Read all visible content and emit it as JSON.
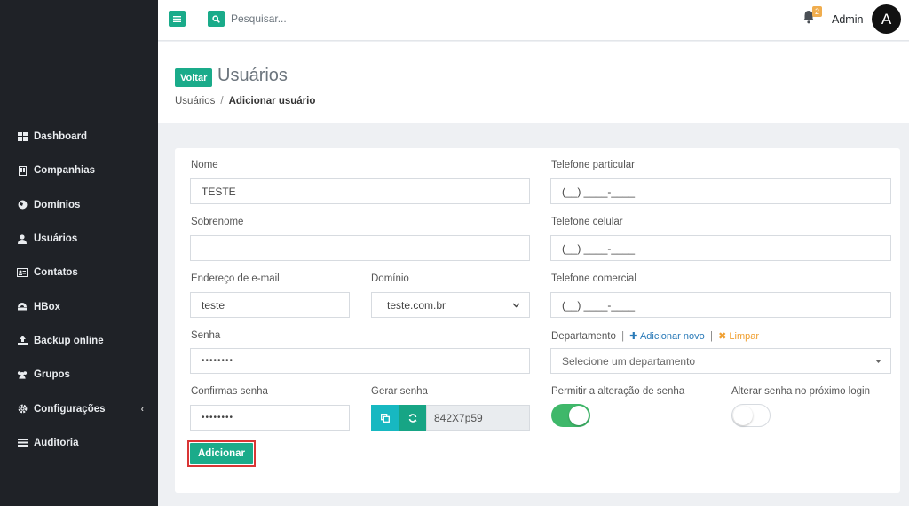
{
  "sidebar": {
    "items": [
      {
        "label": "Dashboard",
        "icon": "dashboard-icon"
      },
      {
        "label": "Companhias",
        "icon": "building-icon"
      },
      {
        "label": "Domínios",
        "icon": "globe-icon"
      },
      {
        "label": "Usuários",
        "icon": "user-icon"
      },
      {
        "label": "Contatos",
        "icon": "address-card-icon"
      },
      {
        "label": "HBox",
        "icon": "hbox-icon"
      },
      {
        "label": "Backup online",
        "icon": "upload-icon"
      },
      {
        "label": "Grupos",
        "icon": "users-icon"
      },
      {
        "label": "Configurações",
        "icon": "gear-icon"
      },
      {
        "label": "Auditoria",
        "icon": "list-icon"
      }
    ]
  },
  "topbar": {
    "search_placeholder": "Pesquisar...",
    "notification_count": "2",
    "user_name": "Admin",
    "avatar_letter": "A"
  },
  "header": {
    "back_label": "Voltar",
    "title": "Usuários",
    "breadcrumb": {
      "parent": "Usuários",
      "separator": "/",
      "current": "Adicionar usuário"
    }
  },
  "form": {
    "nome": {
      "label": "Nome",
      "value": "TESTE"
    },
    "sobrenome": {
      "label": "Sobrenome",
      "value": ""
    },
    "email": {
      "label": "Endereço de e-mail",
      "value": "teste"
    },
    "dominio": {
      "label": "Domínio",
      "value": "teste.com.br"
    },
    "senha": {
      "label": "Senha",
      "value": "••••••••"
    },
    "confirma": {
      "label": "Confirmas senha",
      "value": "••••••••"
    },
    "gerar": {
      "label": "Gerar senha",
      "value": "842X7p59"
    },
    "tel_particular": {
      "label": "Telefone particular",
      "value": "(__) ____-____"
    },
    "tel_celular": {
      "label": "Telefone celular",
      "value": "(__) ____-____"
    },
    "tel_comercial": {
      "label": "Telefone comercial",
      "value": "(__) ____-____"
    },
    "departamento": {
      "label": "Departamento",
      "sep": "|",
      "add_new": "Adicionar novo",
      "clear": "Limpar",
      "placeholder": "Selecione um departamento"
    },
    "permitir_alteracao": {
      "label": "Permitir a alteração de senha",
      "enabled": true
    },
    "alterar_proximo": {
      "label": "Alterar senha no próximo login",
      "enabled": false
    },
    "submit_label": "Adicionar"
  },
  "colors": {
    "accent": "#1aab8a",
    "sidebar_bg": "#1f2227",
    "toggle_on": "#3fb86a",
    "highlight_border": "#d93535"
  }
}
